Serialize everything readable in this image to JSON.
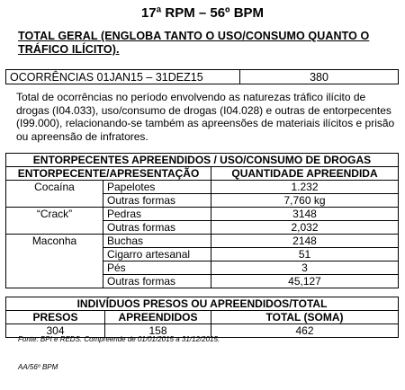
{
  "title": "17ª RPM – 56º BPM",
  "intro": "TOTAL GERAL (ENGLOBA TANTO O USO/CONSUMO QUANTO O TRÁFICO ILÍCITO).",
  "occurrences": {
    "label": "OCORRÊNCIAS 01JAN15 – 31DEZ15",
    "value": "380"
  },
  "paragraph": "Total de ocorrências no período envolvendo as naturezas tráfico ilícito de drogas (I04.033), uso/consumo de drogas (I04.028) e outras de entorpecentes (I99.000), relacionando-se também as apreensões de materiais ilícitos e prisão ou apreensão de infratores.",
  "drugs": {
    "title": "ENTORPECENTES APREENDIDOS / USO/CONSUMO DE DROGAS",
    "col1": "ENTORPECENTE/APRESENTAÇÃO",
    "col2": "QUANTIDADE APREENDIDA",
    "groups": [
      {
        "name": "Cocaína",
        "rows": [
          {
            "form": "Papelotes",
            "qty": "1.232"
          },
          {
            "form": "Outras formas",
            "qty": "7,760 kg"
          }
        ]
      },
      {
        "name": "“Crack”",
        "rows": [
          {
            "form": "Pedras",
            "qty": "3148"
          },
          {
            "form": "Outras formas",
            "qty": "2,032"
          }
        ]
      },
      {
        "name": "Maconha",
        "rows": [
          {
            "form": "Buchas",
            "qty": "2148"
          },
          {
            "form": "Cigarro artesanal",
            "qty": "51"
          },
          {
            "form": "Pés",
            "qty": "3"
          },
          {
            "form": "Outras formas",
            "qty": "45,127"
          }
        ]
      }
    ]
  },
  "arrests": {
    "title": "INDIVÍDUOS PRESOS OU APREENDIDOS/TOTAL",
    "headers": [
      "PRESOS",
      "APREENDIDOS",
      "TOTAL (SOMA)"
    ],
    "values": [
      "304",
      "158",
      "462"
    ]
  },
  "source": "Fonte: BPI e REDS. Compreende de 01/01/2015 a 31/12/2015.",
  "footer": "AA/56º BPM"
}
